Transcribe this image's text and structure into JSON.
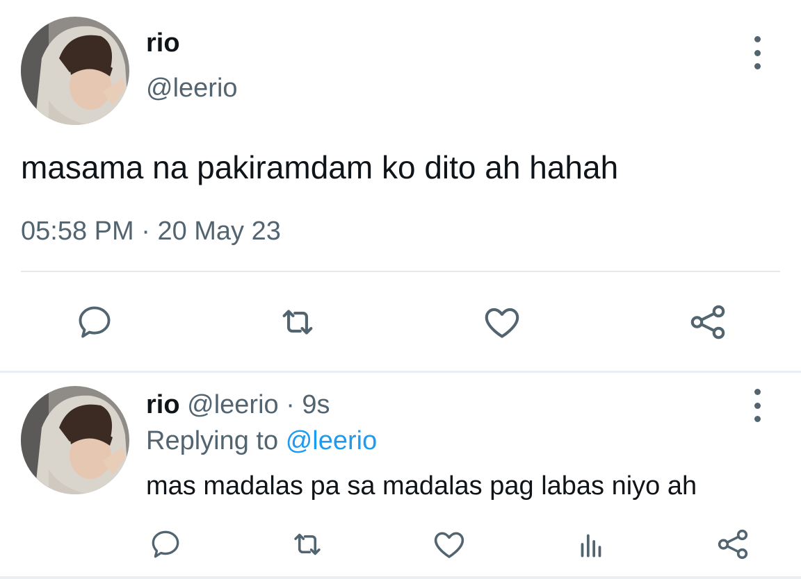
{
  "main_tweet": {
    "author_name": "rio",
    "author_handle": "@leerio",
    "text": "masama na pakiramdam ko dito ah hahah",
    "time": "05:58 PM",
    "separator": "·",
    "date": "20 May 23",
    "actions": [
      "reply-icon",
      "retweet-icon",
      "like-icon",
      "share-icon"
    ]
  },
  "reply_tweet": {
    "author_name": "rio",
    "author_handle": "@leerio",
    "separator": "·",
    "relative_time": "9s",
    "replying_label": "Replying to",
    "replying_to": "@leerio",
    "text": "mas madalas pa sa madalas pag labas niyo ah",
    "actions": [
      "reply-icon",
      "retweet-icon",
      "like-icon",
      "analytics-icon",
      "share-icon"
    ]
  },
  "colors": {
    "text_primary": "#0f1419",
    "text_secondary": "#536471",
    "link": "#1d9bf0",
    "divider": "#e6e9eb"
  }
}
